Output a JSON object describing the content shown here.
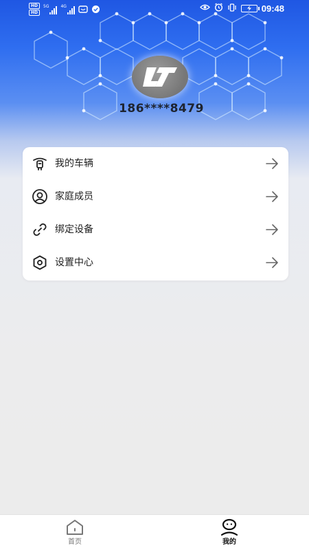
{
  "status_bar": {
    "hd_top": "HD",
    "hd_bottom": "HD",
    "net_top": "5G",
    "net_bottom": "4G",
    "net_mid": "4G",
    "time": "09:48"
  },
  "profile": {
    "avatar_text": "L7",
    "phone": "186****8479"
  },
  "menu": {
    "items": [
      {
        "label": "我的车辆",
        "icon": "scooter-icon"
      },
      {
        "label": "家庭成员",
        "icon": "user-circle-icon"
      },
      {
        "label": "绑定设备",
        "icon": "link-icon"
      },
      {
        "label": "设置中心",
        "icon": "settings-hexagon-icon"
      }
    ],
    "arrow_icon": "arrow-right-icon"
  },
  "bottom_nav": {
    "home_label": "首页",
    "mine_label": "我的",
    "home_icon": "home-icon",
    "mine_icon": "profile-icon",
    "active": "我的"
  }
}
